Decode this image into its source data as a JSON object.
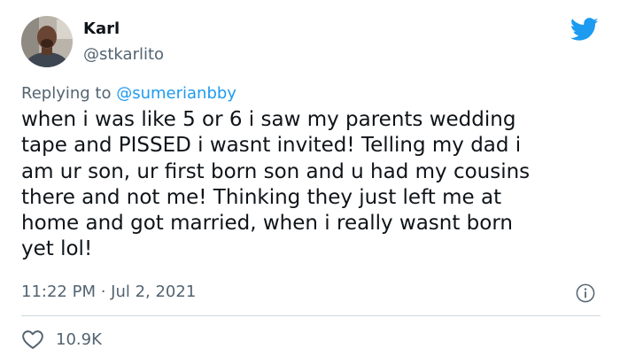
{
  "user": {
    "display_name": "Karl",
    "handle": "@stkarlito"
  },
  "reply": {
    "prefix": "Replying to ",
    "mention": "@sumerianbby"
  },
  "tweet": {
    "text": "when i was like 5 or 6 i saw my parents wedding\ntape and PISSED i wasnt invited! Telling my dad i\nam ur son, ur first born son and u had my cousins\nthere and not me! Thinking they just left me at\nhome and got married, when i really wasnt born\nyet lol!",
    "timestamp": "11:22 PM · Jul 2, 2021"
  },
  "stats": {
    "likes": "10.9K"
  },
  "icons": {
    "brand": "twitter-bird-icon",
    "info": "info-icon",
    "like": "heart-outline-icon"
  },
  "colors": {
    "brand_blue": "#1d9bf0",
    "text_primary": "#0f1419",
    "text_secondary": "#536471",
    "divider": "#cfd9de"
  }
}
